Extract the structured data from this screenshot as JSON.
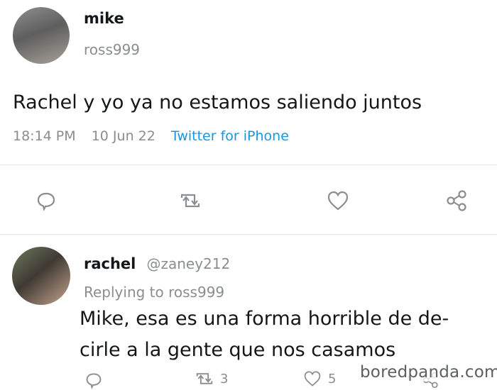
{
  "tweet": {
    "user_name": "mike",
    "user_handle": "ross999",
    "text": "Rachel y yo ya no estamos saliendo juntos",
    "time": "18:14 PM",
    "date": "10 Jun 22",
    "source": "Twitter for iPhone"
  },
  "reply": {
    "user_name": "rachel",
    "user_handle": "@zaney212",
    "replying_to": "Replying to ross999",
    "text_line1": "Mike, esa es una forma horrible de de-",
    "text_line2": "cirle a la gente que nos casamos",
    "retweet_count": "3",
    "like_count": "5"
  },
  "watermark": "boredpanda.com",
  "icons": {
    "reply": "reply-icon",
    "retweet": "retweet-icon",
    "like": "heart-icon",
    "share": "share-icon"
  }
}
